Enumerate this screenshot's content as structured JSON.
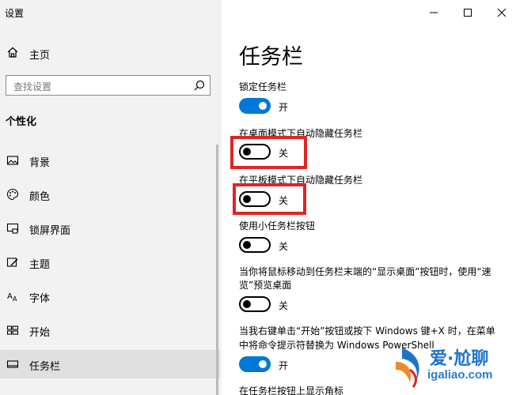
{
  "window": {
    "title": "设置"
  },
  "sidebar": {
    "home_label": "主页",
    "search_placeholder": "查找设置",
    "section_title": "个性化",
    "items": [
      {
        "label": "背景",
        "icon": "image-icon"
      },
      {
        "label": "颜色",
        "icon": "palette-icon"
      },
      {
        "label": "锁屏界面",
        "icon": "lock-screen-icon"
      },
      {
        "label": "主题",
        "icon": "theme-brush-icon"
      },
      {
        "label": "字体",
        "icon": "font-icon"
      },
      {
        "label": "开始",
        "icon": "start-grid-icon"
      },
      {
        "label": "任务栏",
        "icon": "taskbar-icon",
        "active": true
      }
    ]
  },
  "main": {
    "title": "任务栏",
    "settings": [
      {
        "label": "锁定任务栏",
        "state": "开",
        "on": true
      },
      {
        "label": "在桌面模式下自动隐藏任务栏",
        "state": "关",
        "on": false,
        "highlighted": true
      },
      {
        "label": "在平板模式下自动隐藏任务栏",
        "state": "关",
        "on": false,
        "highlighted": true
      },
      {
        "label": "使用小任务栏按钮",
        "state": "关",
        "on": false
      },
      {
        "label_line1": "当你将鼠标移动到任务栏末端的“显示桌面”按钮时，使用“速",
        "label_line2": "览”预览桌面",
        "state": "关",
        "on": false
      },
      {
        "label_line1": "当我右键单击“开始”按钮或按下 Windows 键+X 时，在菜单",
        "label_line2": "中将命令提示符替换为 Windows PowerShell",
        "state": "开",
        "on": true
      },
      {
        "label": "在任务栏按钮上显示角标"
      }
    ]
  },
  "watermark": {
    "line1": "爱·尬聊",
    "line2": "igaliao.com"
  },
  "colors": {
    "accent": "#0078d7",
    "highlight": "#e02424",
    "sidebar_bg": "#f2f2f2"
  }
}
